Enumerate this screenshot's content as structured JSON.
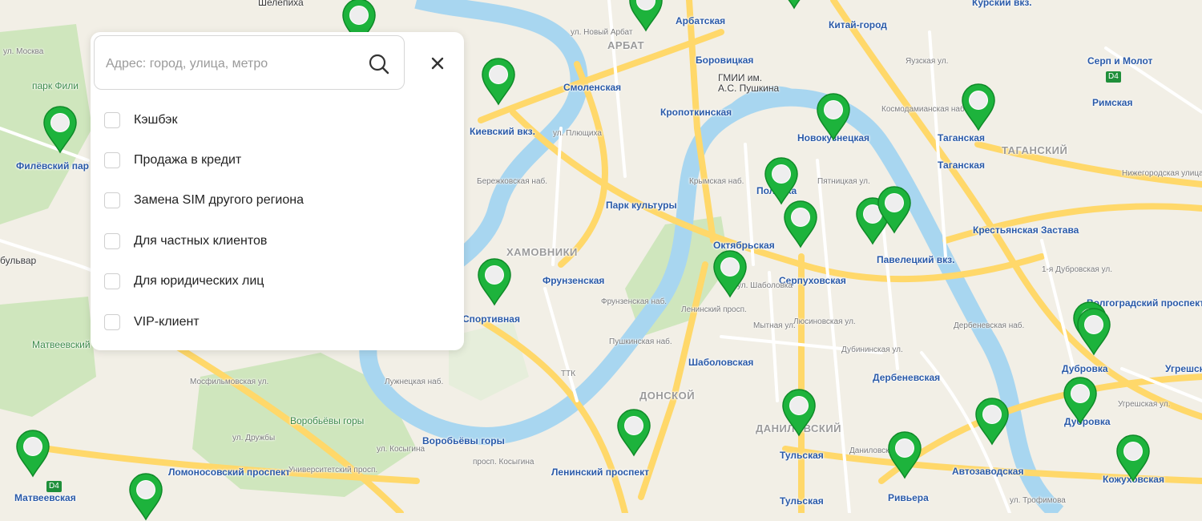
{
  "colors": {
    "pin": "#1db33c",
    "pin_dark": "#0f8a28",
    "metro": "#e0302b",
    "river": "#a8d6f0",
    "park": "#cfe6bd",
    "road_major": "#ffd86a",
    "road_minor": "#ffffff"
  },
  "panel": {
    "search": {
      "placeholder": "Адрес: город, улица, метро",
      "value": ""
    },
    "icons": {
      "search": "search-icon",
      "close": "close-icon"
    },
    "close_label": "×",
    "filters": [
      {
        "label": "Кэшбэк",
        "checked": false
      },
      {
        "label": "Продажа в кредит",
        "checked": false
      },
      {
        "label": "Замена SIM другого региона",
        "checked": false
      },
      {
        "label": "Для частных клиентов",
        "checked": false
      },
      {
        "label": "Для юридических лиц",
        "checked": false
      },
      {
        "label": "VIP-клиент",
        "checked": false
      }
    ]
  },
  "map": {
    "metro_stations": [
      "Арбатская",
      "Китай-город",
      "Боровицкая",
      "Смоленская",
      "Кропоткинская",
      "Новокузнецкая",
      "Таганская",
      "Таганская",
      "Римская",
      "Полянка",
      "Парк культуры",
      "Октябрьская",
      "Серпуховская",
      "Фрунзенская",
      "Спортивная",
      "Шаболовская",
      "Тульская",
      "Ленинский проспект",
      "Воробьёвы горы",
      "Ломоносовский проспект",
      "Автозаводская",
      "Дубровка",
      "Дубровка",
      "Кожуховская",
      "Крестьянская Застава",
      "Волгоградский проспект",
      "Угрешская",
      "Дербеневская",
      "Павелецкий вкз.",
      "Киевский вкз.",
      "Серп и Молот",
      "Филёвский пар",
      "Матвеевская",
      "Матвеевский",
      "Тульская",
      "Ривьера",
      "Шелепиха",
      "Курский вкз."
    ],
    "districts": [
      "АРБАТ",
      "ХАМОВНИКИ",
      "ДОНСКОЙ",
      "ДАНИЛОВСКИЙ",
      "ТАГАНСКИЙ"
    ],
    "places": [
      "парк Фили",
      "ГМИИ им.",
      "А.С. Пушкина",
      "Воробьёвы горы",
      "бульвар",
      "ул. Москва"
    ],
    "streets": [
      "ул. Новый Арбат",
      "ул. Плющиха",
      "Бережковская наб.",
      "Фрунзенская наб.",
      "Пушкинская наб.",
      "Лужнецкая наб.",
      "Ленинский просп.",
      "ул. Шаболовка",
      "Мытная ул.",
      "Люсиновская ул.",
      "Дубининская ул.",
      "Дербеневская наб.",
      "Пятницкая ул.",
      "Космодамианская наб.",
      "Нижегородская улица",
      "1-я Дубровская ул.",
      "Угрешская ул.",
      "ул. Косыгина",
      "просп. Косыгина",
      "Мосфильмовская ул.",
      "ул. Дружбы",
      "Университетский просп.",
      "ТТК",
      "Даниловская наб.",
      "ул. Трофимова",
      "Крымская наб.",
      "Яузская ул."
    ],
    "badges": [
      "D4",
      "D4"
    ],
    "pins_count": 27
  }
}
